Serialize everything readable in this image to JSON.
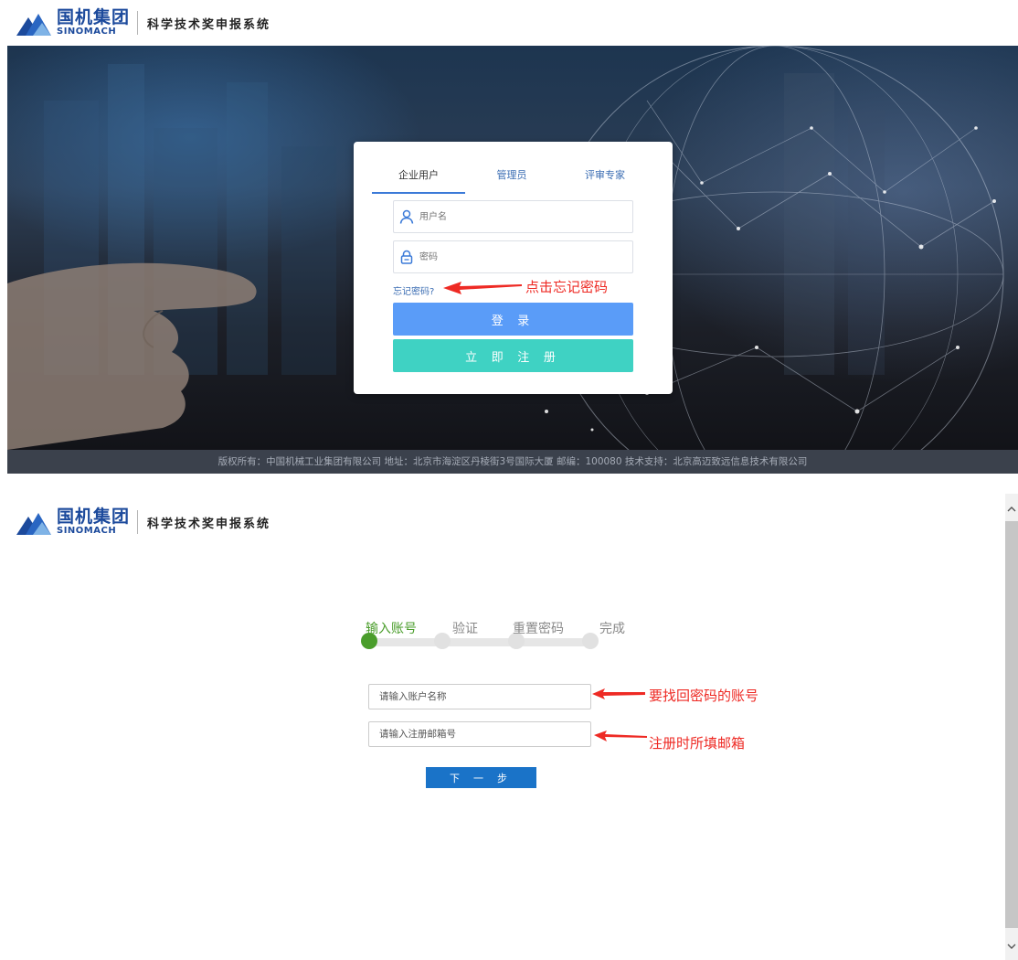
{
  "header": {
    "logo_cn": "国机集团",
    "logo_en": "SINOMACH",
    "system_title": "科学技术奖申报系统"
  },
  "login": {
    "tabs": [
      "企业用户",
      "管理员",
      "评审专家"
    ],
    "username_placeholder": "用户名",
    "password_placeholder": "密码",
    "forgot_link": "忘记密码?",
    "login_button": "登 录",
    "register_button": "立 即 注 册"
  },
  "annotations": {
    "click_forgot": "点击忘记密码",
    "account_to_recover": "要找回密码的账号",
    "registered_email": "注册时所填邮箱"
  },
  "footer": "版权所有：中国机械工业集团有限公司 地址：北京市海淀区丹棱街3号国际大厦 邮编：100080 技术支持：北京高迈致远信息技术有限公司",
  "recovery": {
    "steps": [
      {
        "label": "输入账号",
        "active": true
      },
      {
        "label": "验证",
        "active": false
      },
      {
        "label": "重置密码",
        "active": false
      },
      {
        "label": "完成",
        "active": false
      }
    ],
    "account_placeholder": "请输入账户名称",
    "email_placeholder": "请输入注册邮箱号",
    "next_button": "下 一 步"
  },
  "colors": {
    "brand_blue": "#1c4a9c",
    "login_button": "#5a9cf8",
    "register_button": "#3fd2c3",
    "step_active": "#4a9d2b",
    "annotation_red": "#ee2a24",
    "next_button": "#1a73c8"
  },
  "icons": {
    "user": "user-icon",
    "lock": "lock-icon",
    "arrow": "red-arrow-icon",
    "scroll_up": "chevron-up-icon",
    "scroll_down": "chevron-down-icon"
  }
}
